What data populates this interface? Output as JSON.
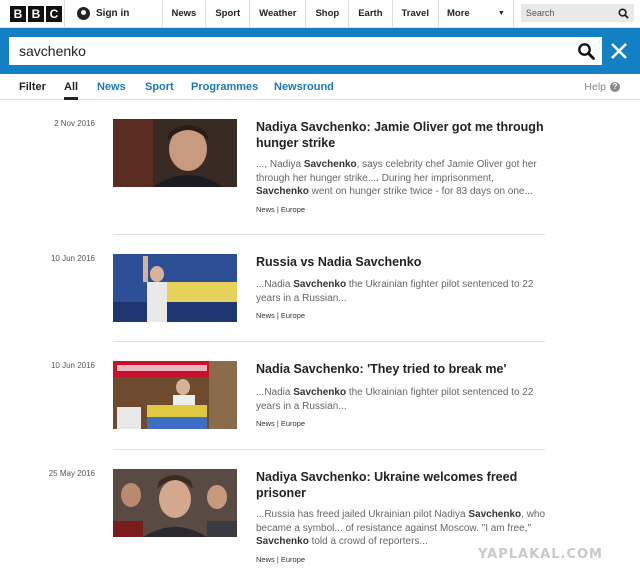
{
  "topnav": {
    "logo_letters": [
      "B",
      "B",
      "C"
    ],
    "signin_label": "Sign in",
    "items": [
      "News",
      "Sport",
      "Weather",
      "Shop",
      "Earth",
      "Travel"
    ],
    "more_label": "More",
    "search_placeholder": "Search"
  },
  "search": {
    "query": "savchenko"
  },
  "filters": {
    "label": "Filter",
    "tabs": [
      "All",
      "News",
      "Sport",
      "Programmes",
      "Newsround"
    ],
    "active": "All",
    "help_label": "Help"
  },
  "results": [
    {
      "date": "2 Nov 2016",
      "title": "Nadiya Savchenko: Jamie Oliver got me through hunger strike",
      "snippet": [
        "..., Nadiya ",
        "Savchenko",
        ", says celebrity chef Jamie Oliver got her through her hunger strike.... During her imprisonment, ",
        "Savchenko",
        " went on hunger strike twice - for 83 days on one..."
      ],
      "tags": "News | Europe",
      "thumb_icon": "portrait-photo-icon"
    },
    {
      "date": "10 Jun 2016",
      "title": "Russia vs Nadia Savchenko",
      "snippet": [
        "...Nadia ",
        "Savchenko",
        " the Ukrainian fighter pilot sentenced to 22 years in a Russian..."
      ],
      "tags": "News | Europe",
      "thumb_icon": "raised-fist-photo-icon"
    },
    {
      "date": "10 Jun 2016",
      "title": "Nadia Savchenko: 'They tried to break me'",
      "snippet": [
        "...Nadia ",
        "Savchenko",
        " the Ukrainian fighter pilot sentenced to 22 years in a Russian..."
      ],
      "tags": "News | Europe",
      "thumb_icon": "parliament-podium-photo-icon"
    },
    {
      "date": "25 May 2016",
      "title": "Nadiya Savchenko: Ukraine welcomes freed prisoner",
      "snippet": [
        "...Russia has freed jailed Ukrainian pilot Nadiya ",
        "Savchenko",
        ", who became a symbol... of resistance against Moscow. \"I am free,\" ",
        "Savchenko",
        " told a crowd of reporters..."
      ],
      "tags": "News | Europe",
      "thumb_icon": "crowd-photo-icon"
    }
  ],
  "watermark": "YAPLAKAL.COM",
  "colors": {
    "band_blue": "#1380c4",
    "tab_blue": "#1a7ab9",
    "banner_red": "#c8102e"
  }
}
